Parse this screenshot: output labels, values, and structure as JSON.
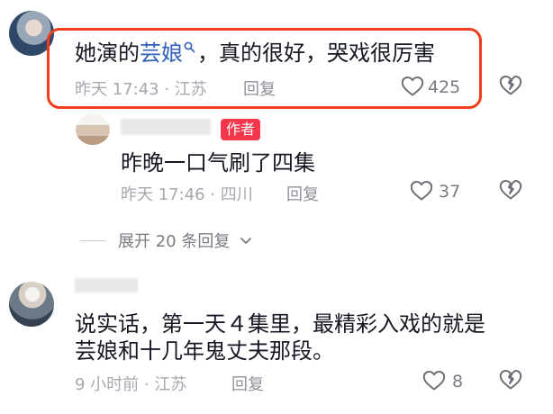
{
  "comment1": {
    "text_prefix": "她演的",
    "link_text": "芸娘",
    "text_suffix": "，真的很好，哭戏很厉害",
    "meta": "昨天 17:43 · 江苏",
    "reply_label": "回复",
    "like_count": "425"
  },
  "reply1": {
    "author_tag": "作者",
    "text": "昨晚一口气刷了四集",
    "meta": "昨天 17:46 · 四川",
    "reply_label": "回复",
    "like_count": "37"
  },
  "expand": {
    "label": "展开 20 条回复"
  },
  "comment2": {
    "text_line1": "说实话，第一天４集里，最精彩入戏的就是",
    "text_line2": "芸娘和十几年鬼丈夫那段。",
    "meta": "9 小时前 · 江苏",
    "reply_label": "回复",
    "like_count": "8"
  },
  "icons": {
    "like": "heart-icon",
    "dislike": "broken-heart-icon",
    "search": "search-icon",
    "expand": "chevron-down-icon"
  },
  "colors": {
    "highlight": "#f23d1c",
    "link": "#315fb9",
    "author_tag": "#f4374b"
  }
}
